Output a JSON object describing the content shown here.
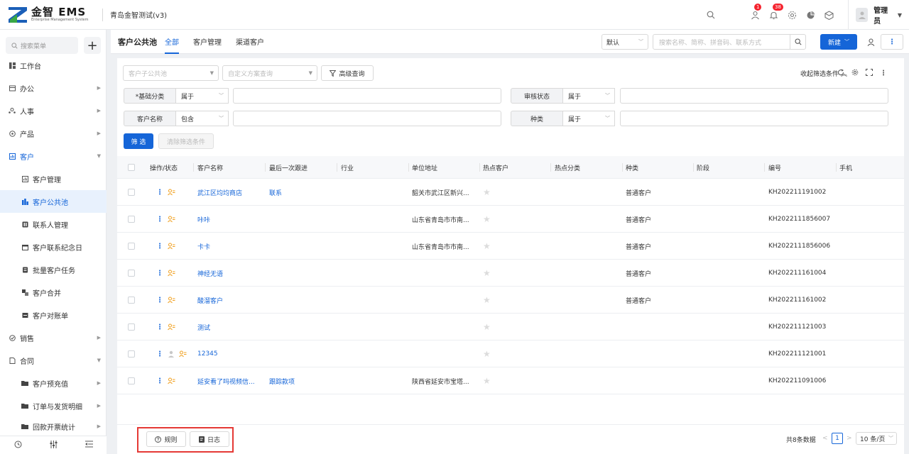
{
  "header": {
    "logo_title": "金智 EMS",
    "logo_sub": "Enterprise Management System",
    "company": "青岛金智测试(v3)",
    "badge_todo": "1",
    "badge_notice": "38",
    "user_name": "管理员"
  },
  "sidebar": {
    "search_placeholder": "搜索菜单",
    "items": [
      {
        "label": "工作台",
        "icon": "dashboard-icon"
      },
      {
        "label": "办公",
        "icon": "office-icon"
      },
      {
        "label": "人事",
        "icon": "people-icon"
      },
      {
        "label": "产品",
        "icon": "product-icon"
      },
      {
        "label": "客户",
        "icon": "customer-icon"
      },
      {
        "label": "客户管理",
        "icon": "customer-manage-icon"
      },
      {
        "label": "客户公共池",
        "icon": "pool-icon"
      },
      {
        "label": "联系人管理",
        "icon": "contact-icon"
      },
      {
        "label": "客户联系纪念日",
        "icon": "calendar-icon"
      },
      {
        "label": "批量客户任务",
        "icon": "task-icon"
      },
      {
        "label": "客户合并",
        "icon": "merge-icon"
      },
      {
        "label": "客户对账单",
        "icon": "statement-icon"
      },
      {
        "label": "销售",
        "icon": "sales-icon"
      },
      {
        "label": "合同",
        "icon": "contract-icon"
      },
      {
        "label": "客户预充值",
        "icon": "folder-icon"
      },
      {
        "label": "订单与发货明细",
        "icon": "folder-icon"
      },
      {
        "label": "回款开票统计",
        "icon": "folder-icon"
      }
    ]
  },
  "tabsbar": {
    "page_title": "客户公共池",
    "tabs": [
      "全部",
      "客户管理",
      "渠道客户"
    ],
    "sort_select": "默认",
    "search_placeholder": "搜索名称、简称、拼音码、联系方式",
    "new_button": "新建"
  },
  "filters": {
    "pool_placeholder": "客户子公共池",
    "scheme_placeholder": "自定义方案查询",
    "advanced": "高级查询",
    "collapse": "收起筛选条件",
    "rows": [
      {
        "label": "*基础分类",
        "op": "属于"
      },
      {
        "label": "审核状态",
        "op": "属于"
      },
      {
        "label": "客户名称",
        "op": "包含"
      },
      {
        "label": "种类",
        "op": "属于"
      }
    ],
    "filter_button": "筛 选",
    "clear_button": "清除筛选条件"
  },
  "table": {
    "columns": [
      "操作/状态",
      "客户名称",
      "最后一次跟进",
      "行业",
      "单位地址",
      "热点客户",
      "热点分类",
      "种类",
      "阶段",
      "编号",
      "手机"
    ],
    "rows": [
      {
        "name": "武江区均均商店",
        "follow": "联系",
        "address": "韶关市武江区新兴...",
        "kind": "普通客户",
        "code": "KH202211191002"
      },
      {
        "name": "咔咔",
        "follow": "",
        "address": "山东省青岛市市南...",
        "kind": "普通客户",
        "code": "KH2022111856007"
      },
      {
        "name": "卡卡",
        "follow": "",
        "address": "山东省青岛市市南...",
        "kind": "普通客户",
        "code": "KH2022111856006"
      },
      {
        "name": "神经无语",
        "follow": "",
        "address": "",
        "kind": "普通客户",
        "code": "KH202211161004"
      },
      {
        "name": "酸溜客户",
        "follow": "",
        "address": "",
        "kind": "普通客户",
        "code": "KH202211161002"
      },
      {
        "name": "测试",
        "follow": "",
        "address": "",
        "kind": "",
        "code": "KH202211121003"
      },
      {
        "name": "12345",
        "follow": "",
        "address": "",
        "kind": "",
        "code": "KH202211121001"
      },
      {
        "name": "延安看了吗视频信...",
        "follow": "跟踪款项",
        "address": "陕西省延安市宝塔...",
        "kind": "",
        "code": "KH202211091006"
      }
    ]
  },
  "footer": {
    "rules_button": "规则",
    "log_button": "日志",
    "total": "共8条数据",
    "current_page": "1",
    "page_size": "10 条/页"
  }
}
